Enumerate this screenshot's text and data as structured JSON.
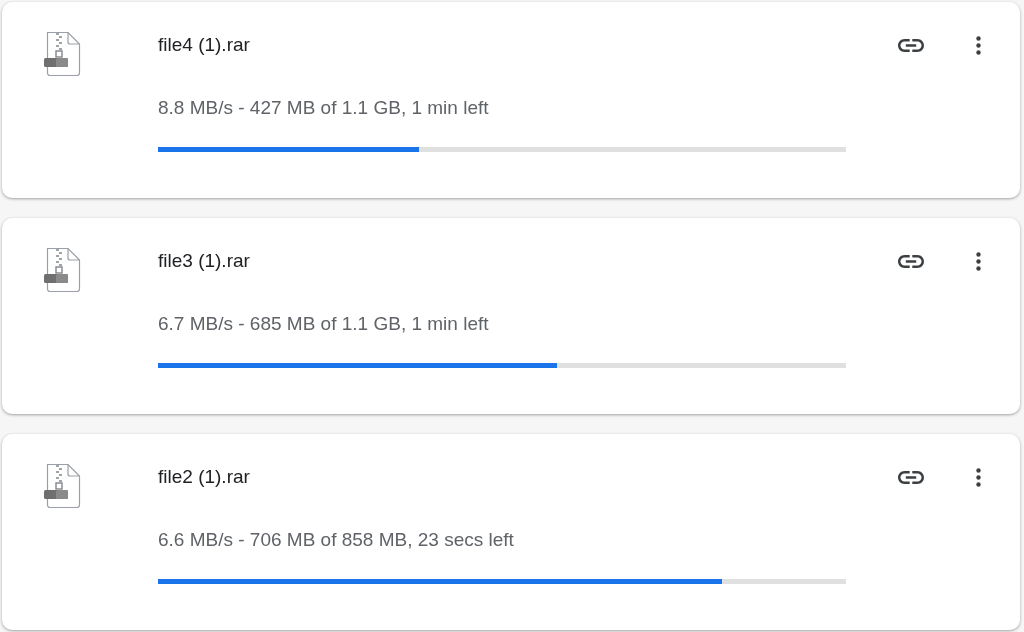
{
  "downloads": [
    {
      "file_name": "file4 (1).rar",
      "status": "8.8 MB/s - 427 MB of 1.1 GB, 1 min left",
      "level": 0.38
    },
    {
      "file_name": "file3 (1).rar",
      "status": "6.7 MB/s - 685 MB of 1.1 GB, 1 min left",
      "level": 0.58
    },
    {
      "file_name": "file2 (1).rar",
      "status": "6.6 MB/s - 706 MB of 858 MB, 23 secs left",
      "level": 0.82
    }
  ]
}
